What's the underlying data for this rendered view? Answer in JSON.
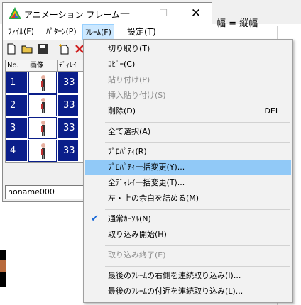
{
  "background_app": {
    "title_fragment": "幅 = 縦幅"
  },
  "window": {
    "title": "アニメーション フレーム",
    "min_glyph": "—",
    "max_glyph": "☐",
    "close_glyph": "✕",
    "menu": [
      {
        "label": "ﾌｧｲﾙ(F)"
      },
      {
        "label": "ﾊﾟﾀｰﾝ(P)"
      },
      {
        "label": "ﾌﾚｰﾑ(F)"
      },
      {
        "label": "設定(T)"
      }
    ],
    "table": {
      "headers": [
        "No.",
        "画像",
        "ﾃﾞｨﾚｲ"
      ],
      "rows": [
        {
          "no": "1",
          "delay": "33"
        },
        {
          "no": "2",
          "delay": "33"
        },
        {
          "no": "3",
          "delay": "33"
        },
        {
          "no": "4",
          "delay": "33"
        }
      ]
    },
    "name_field": "noname000"
  },
  "context_menu": {
    "items": [
      {
        "label": "切り取り(T)",
        "shortcut": "",
        "disabled": false
      },
      {
        "label": "ｺﾋﾟｰ(C)",
        "shortcut": "",
        "disabled": false
      },
      {
        "label": "貼り付け(P)",
        "shortcut": "",
        "disabled": true
      },
      {
        "label": "挿入貼り付け(S)",
        "shortcut": "",
        "disabled": true
      },
      {
        "label": "削除(D)",
        "shortcut": "DEL",
        "disabled": false
      },
      {
        "label": "全て選択(A)",
        "shortcut": "",
        "disabled": false
      },
      {
        "label": "ﾌﾟﾛﾊﾟﾃｨ(R)",
        "shortcut": "",
        "disabled": false
      },
      {
        "label": "ﾌﾟﾛﾊﾟﾃｨ一括変更(Y)...",
        "shortcut": "",
        "disabled": false,
        "highlighted": true
      },
      {
        "label": "全ﾃﾞｨﾚｲ一括変更(T)...",
        "shortcut": "",
        "disabled": false
      },
      {
        "label": "左・上の余白を詰める(M)",
        "shortcut": "",
        "disabled": false
      },
      {
        "label": "通常ｶｰｿﾙ(N)",
        "shortcut": "",
        "disabled": false,
        "checked": true
      },
      {
        "label": "取り込み開始(H)",
        "shortcut": "",
        "disabled": false
      },
      {
        "label": "取り込み終了(E)",
        "shortcut": "",
        "disabled": true
      },
      {
        "label": "最後のﾌﾚｰﾑの右側を連続取り込み(I)...",
        "shortcut": "",
        "disabled": false
      },
      {
        "label": "最後のﾌﾚｰﾑの付近を連続取り込み(L)...",
        "shortcut": "",
        "disabled": false
      }
    ]
  },
  "colors": {
    "selection_blue": "#0a1e8a",
    "menu_highlight": "#91c9f7",
    "check_color": "#1b6ad8"
  }
}
